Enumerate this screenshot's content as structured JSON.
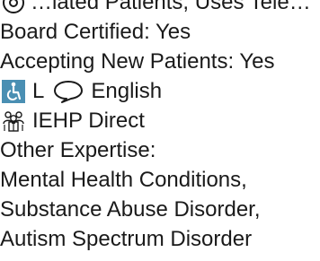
{
  "listing": {
    "top_partial": {
      "icon": "network-globe-icon",
      "text": "…iated Patients, Uses Tele…"
    },
    "board_certified": "Board Certified: Yes",
    "accepting_new_patients": "Accepting New Patients: Yes",
    "accessibility": {
      "icon": "wheelchair-accessibility-icon",
      "code": "L",
      "language_icon": "speech-bubble-icon",
      "language": "English"
    },
    "network": {
      "icon": "group-members-icon",
      "name": "IEHP Direct"
    },
    "other_expertise_label": "Other Expertise:",
    "expertise": [
      "Mental Health Conditions,",
      "Substance Abuse Disorder,",
      "Autism Spectrum Disorder"
    ]
  },
  "colors": {
    "accessibility_icon": "#4a8fb3",
    "icon_stroke": "#1a1a1a"
  }
}
